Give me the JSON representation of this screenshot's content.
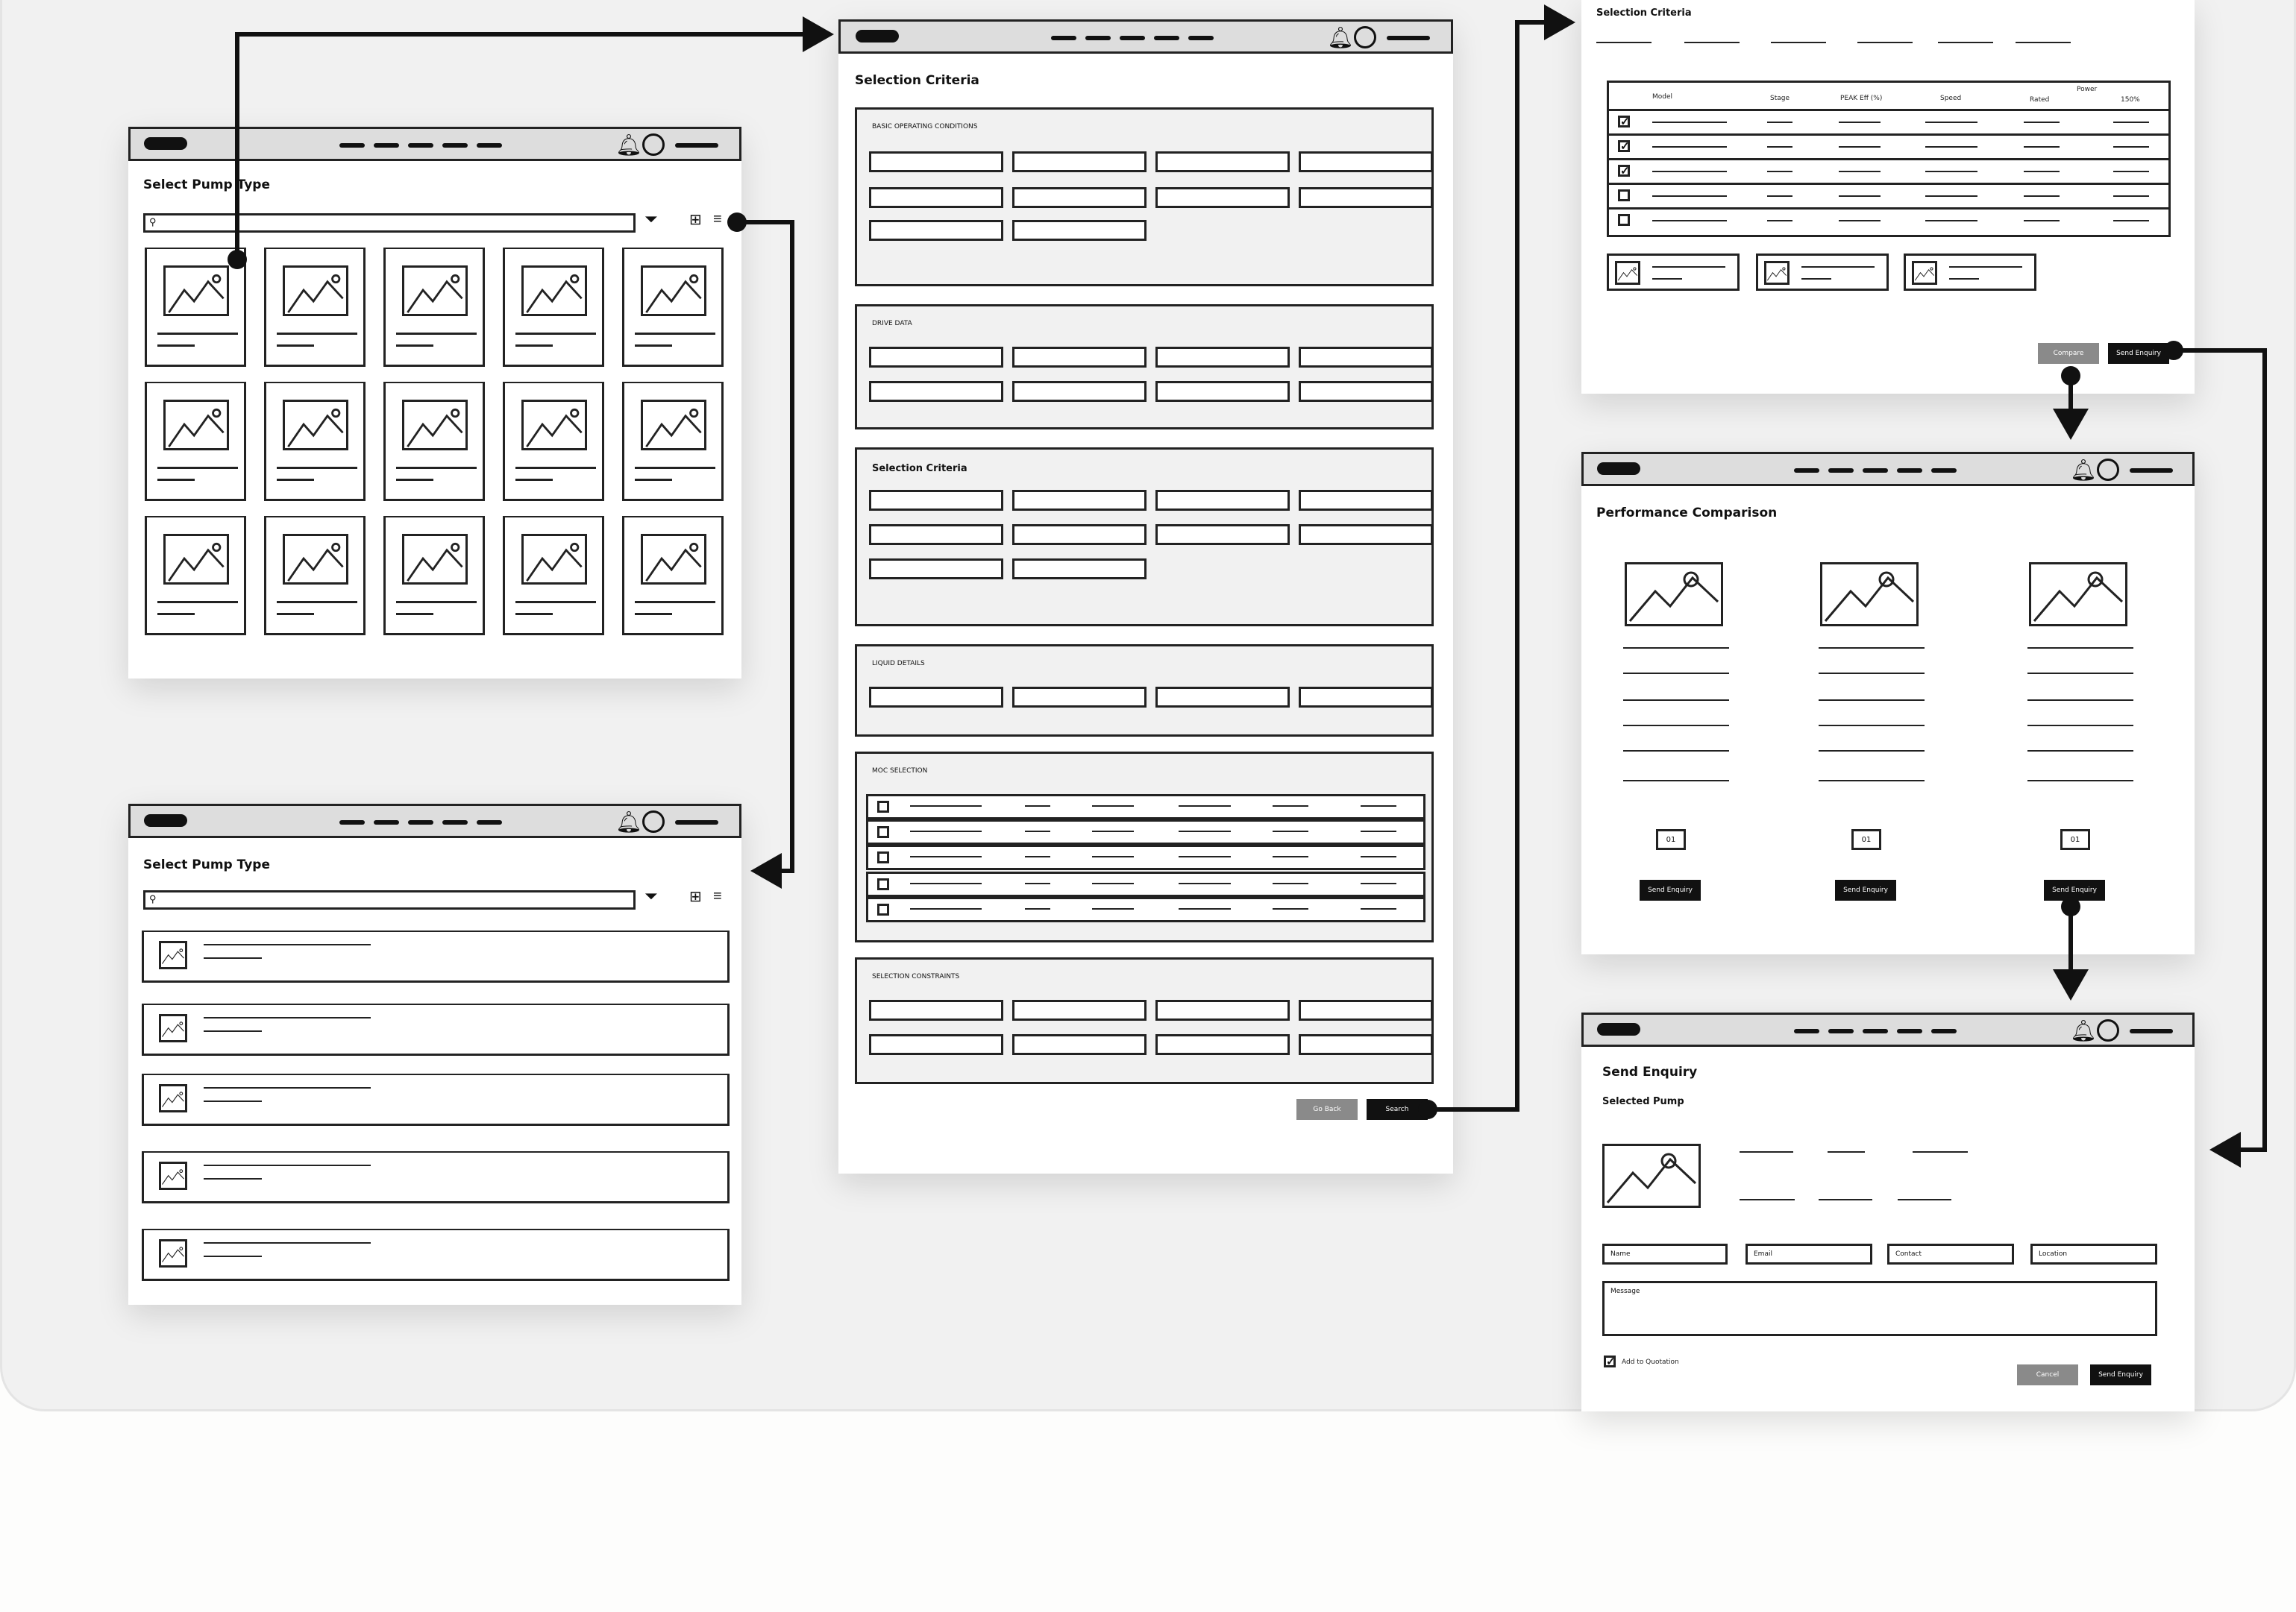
{
  "screens": {
    "grid": {
      "title": "Select Pump Type"
    },
    "list": {
      "title": "Select Pump Type"
    },
    "criteria": {
      "title": "Selection Criteria",
      "sections": {
        "basic": "BASIC OPERATING CONDITIONS",
        "drive": "DRIVE DATA",
        "selection": "Selection Criteria",
        "liquid": "LIQUID DETAILS",
        "moc": "MOC SELECTION",
        "constraints": "SELECTION CONSTRAINTS"
      },
      "go_back": "Go Back",
      "search": "Search"
    },
    "results": {
      "title": "Selection Criteria",
      "columns": {
        "model": "Model",
        "stage": "Stage",
        "peak_eff": "PEAK Eff (%)",
        "speed": "Speed",
        "power": "Power",
        "rated": "Rated",
        "pct150": "150%"
      },
      "checked": [
        true,
        true,
        true,
        false,
        false
      ],
      "compare": "Compare",
      "send_enquiry": "Send Enquiry"
    },
    "comparison": {
      "title": "Performance Comparison",
      "quantities": [
        "01",
        "01",
        "01"
      ],
      "send_enquiry": "Send Enquiry"
    },
    "enquiry": {
      "title": "Send Enquiry",
      "subtitle": "Selected Pump",
      "fields": {
        "name": "Name",
        "email": "Email",
        "contact": "Contact",
        "location": "Location",
        "message": "Message"
      },
      "add_to_quotation": "Add to Quotation",
      "cancel": "Cancel",
      "send": "Send Enquiry"
    }
  },
  "colors": {
    "board": "#f1f1f1",
    "nav": "#dddddd",
    "ink": "#111111",
    "grey_button": "#8a8a8a"
  },
  "icons": [
    "bell-icon",
    "user-icon",
    "search-icon",
    "filter-icon",
    "grid-view-icon",
    "list-view-icon",
    "image-placeholder-icon",
    "checkbox-icon"
  ]
}
